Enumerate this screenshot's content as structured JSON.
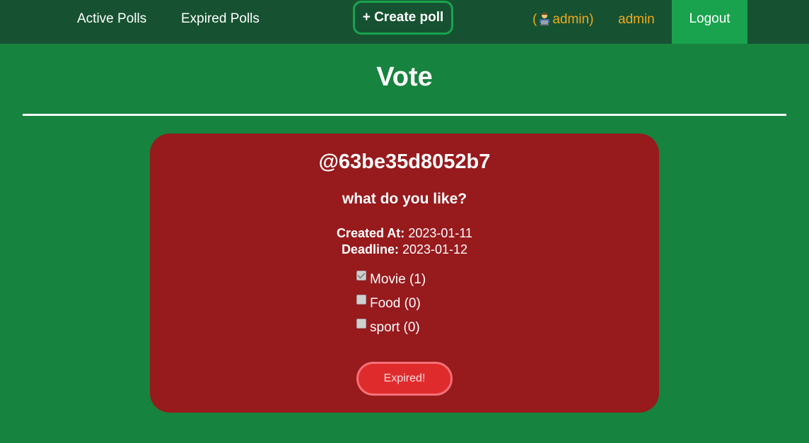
{
  "nav": {
    "active_polls": "Active Polls",
    "expired_polls": "Expired Polls",
    "create_poll": "+ Create poll",
    "user_tag_open": "(",
    "user_tag_name": "admin",
    "user_tag_close": ")",
    "username": "admin",
    "logout": "Logout"
  },
  "page": {
    "title": "Vote"
  },
  "poll": {
    "id": "@63be35d8052b7",
    "question": "what do you like?",
    "created_label": "Created At:",
    "created_value": "2023-01-11",
    "deadline_label": "Deadline:",
    "deadline_value": "2023-01-12",
    "options": [
      {
        "label": "Movie (1)",
        "checked": true
      },
      {
        "label": "Food (0)",
        "checked": false
      },
      {
        "label": "sport (0)",
        "checked": false
      }
    ],
    "status_button": "Expired!"
  },
  "colors": {
    "page_bg": "#16833e",
    "navbar_bg": "#165231",
    "accent_green": "#1aa34e",
    "user_orange": "#f0a81d",
    "card_bg": "#971a1d",
    "expired_btn": "#e02b2d"
  },
  "icons": {
    "user": "technologist-icon"
  }
}
